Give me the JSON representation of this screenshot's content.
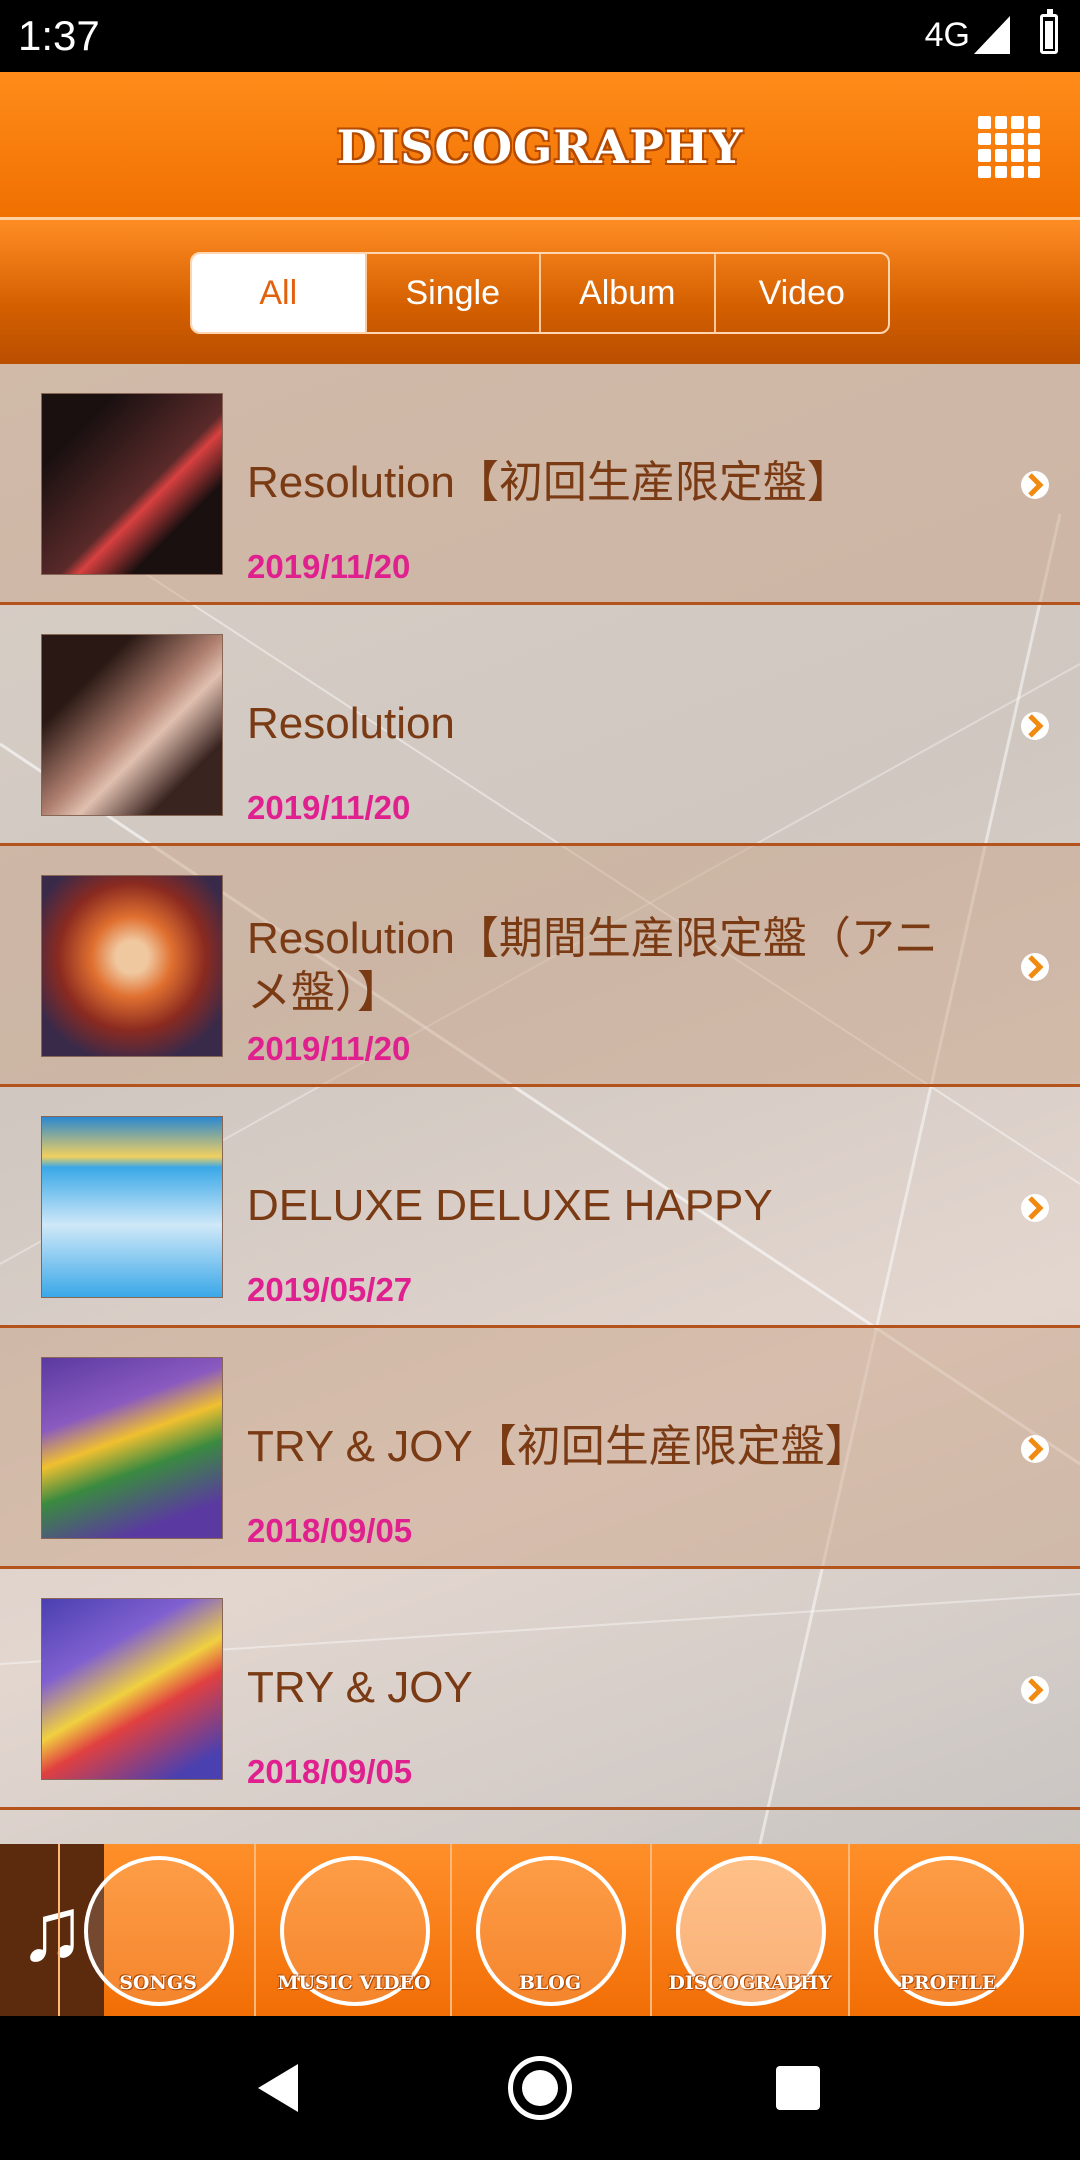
{
  "status_bar": {
    "time": "1:37",
    "network": "4G"
  },
  "header": {
    "title": "DISCOGRAPHY"
  },
  "filter": {
    "tabs": [
      "All",
      "Single",
      "Album",
      "Video"
    ],
    "selected": "All"
  },
  "releases": [
    {
      "title": "Resolution【初回生産限定盤】",
      "date": "2019/11/20",
      "cover_colors": [
        "#2a1a1a",
        "#d84040"
      ]
    },
    {
      "title": "Resolution",
      "date": "2019/11/20",
      "cover_colors": [
        "#3a2420",
        "#c8a090"
      ]
    },
    {
      "title": "Resolution【期間生産限定盤（アニメ盤）】",
      "date": "2019/11/20",
      "cover_colors": [
        "#e07030",
        "#3a2a4a"
      ]
    },
    {
      "title": "DELUXE DELUXE HAPPY",
      "date": "2019/05/27",
      "cover_colors": [
        "#3aa8e8",
        "#f0d060"
      ]
    },
    {
      "title": "TRY & JOY【初回生産限定盤】",
      "date": "2018/09/05",
      "cover_colors": [
        "#5a3aa0",
        "#f0c030"
      ]
    },
    {
      "title": "TRY & JOY",
      "date": "2018/09/05",
      "cover_colors": [
        "#4a40b0",
        "#f0d040"
      ]
    }
  ],
  "bottom_nav": [
    {
      "label": "SONGS",
      "icon": "note-icon"
    },
    {
      "label": "MUSIC VIDEO",
      "icon": "camera-icon"
    },
    {
      "label": "BLOG",
      "icon": "blog-icon"
    },
    {
      "label": "DISCOGRAPHY",
      "icon": "disc-icon",
      "active": true
    },
    {
      "label": "PROFILE",
      "icon": "heart-icon"
    }
  ],
  "colors": {
    "accent": "#f07000",
    "title_text": "#7a3a14",
    "date_text": "#e0208e"
  }
}
